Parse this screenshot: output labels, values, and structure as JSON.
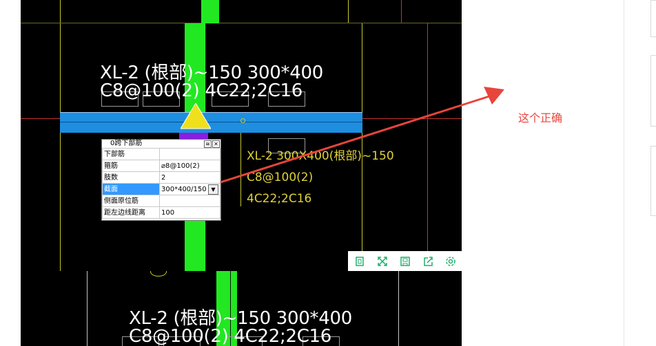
{
  "panel": {
    "title": "0跨下部筋",
    "rows": [
      {
        "key": "下部筋",
        "value": ""
      },
      {
        "key": "箍筋",
        "value": "⌀8@100(2)"
      },
      {
        "key": "肢数",
        "value": "2"
      },
      {
        "key": "截面",
        "value": "300*400/150"
      },
      {
        "key": "侧面原位筋",
        "value": ""
      },
      {
        "key": "距左边线距离",
        "value": "100"
      }
    ],
    "collapse_glyph": "≋",
    "close_glyph": "✕",
    "dropdown_glyph": "▼"
  },
  "top_beam_label": {
    "line1": "XL-2 (根部)~150 300*400",
    "line2": "C8@100(2) 4C22;2C16"
  },
  "yellow_label": {
    "line1": "XL-2 300X400(根部)~150",
    "line2": "C8@100(2)",
    "line3": "4C22;2C16"
  },
  "bottom_beam_label": {
    "line1": "XL-2 (根部)~150 300*400",
    "line2": "C8@100(2) 4C22;2C16"
  },
  "annotation": {
    "note": "这个正确",
    "color": "#e8453c"
  },
  "toolbar": {
    "icons": [
      "crop-icon",
      "fullscreen-icon",
      "save-icon",
      "share-icon",
      "settings-icon"
    ],
    "color": "#1fb06b"
  },
  "colors": {
    "beam_blue": "#1e8ee0",
    "column_green": "#22e822",
    "triangle_yellow": "#f0e01c",
    "purple": "#8a1ee0"
  }
}
